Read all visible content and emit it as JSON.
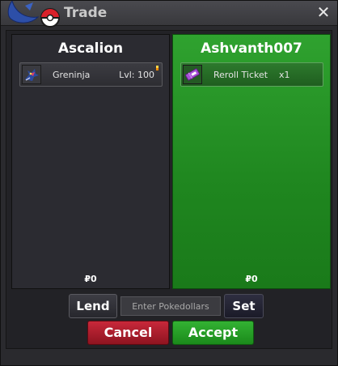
{
  "window": {
    "title": "Trade",
    "close_icon": "close-icon",
    "logo_icon": "pokeball-logo-icon"
  },
  "left_panel": {
    "player": "Ascalion",
    "item": {
      "icon": "greninja-sprite-icon",
      "name": "Greninja",
      "level": "Lvl: 100"
    },
    "money_symbol": "₽",
    "money": "0"
  },
  "right_panel": {
    "player": "Ashvanth007",
    "item": {
      "icon": "reroll-ticket-icon",
      "name": "Reroll Ticket",
      "quantity": "x1"
    },
    "money_symbol": "₽",
    "money": "0"
  },
  "controls": {
    "lend_label": "Lend",
    "money_placeholder": "Enter Pokedollars",
    "set_label": "Set",
    "cancel_label": "Cancel",
    "accept_label": "Accept"
  },
  "colors": {
    "accepted_panel": "#2fa22f",
    "cancel": "#c8283a",
    "accept": "#33b233"
  }
}
